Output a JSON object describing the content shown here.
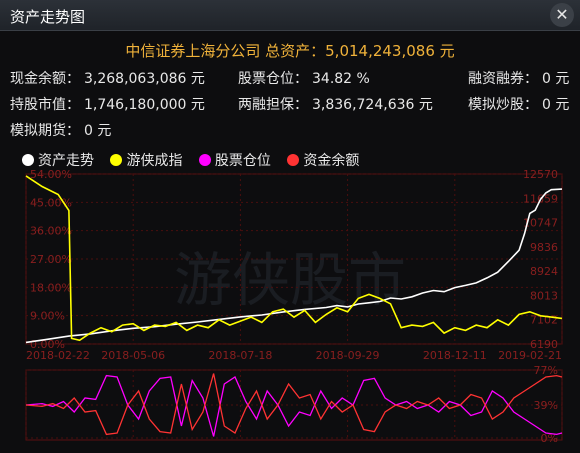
{
  "window": {
    "title": "资产走势图",
    "close_glyph": "✕"
  },
  "summary": {
    "headline": "中信证券上海分公司 总资产：5,014,243,086 元",
    "rows": [
      [
        {
          "label": "现金余额：",
          "value": "3,268,063,086 元"
        },
        {
          "label": "股票仓位：",
          "value": "34.82 %"
        },
        {
          "label": "融资融券：",
          "value": "0 元"
        }
      ],
      [
        {
          "label": "持股市值：",
          "value": "1,746,180,000 元"
        },
        {
          "label": "两融担保：",
          "value": "3,836,724,636 元"
        },
        {
          "label": "模拟炒股：",
          "value": "0 元"
        }
      ],
      [
        {
          "label": "模拟期货：",
          "value": "0 元"
        }
      ]
    ]
  },
  "legend": [
    {
      "name": "资产走势",
      "color": "#ffffff"
    },
    {
      "name": "游侠成指",
      "color": "#ffff00"
    },
    {
      "name": "股票仓位",
      "color": "#ff00ff"
    },
    {
      "name": "资金余额",
      "color": "#ff3333"
    }
  ],
  "watermark": "游侠股市",
  "chart_data": [
    {
      "type": "line",
      "x_ticks": [
        "2018-02-22",
        "2018-05-06",
        "2018-07-18",
        "2018-09-29",
        "2018-12-11",
        "2019-02-21"
      ],
      "y_left_ticks": [
        "0.00%",
        "9.00%",
        "18.00%",
        "27.00%",
        "36.00%",
        "45.00%",
        "54.00%"
      ],
      "y_right_ticks": [
        "6190",
        "7102",
        "8013",
        "8924",
        "9836",
        "10747",
        "11659",
        "12570"
      ],
      "left_range": [
        0,
        54
      ],
      "right_range": [
        6190,
        12570
      ],
      "grid": true,
      "series": [
        {
          "name": "资产走势",
          "color": "#ffffff",
          "axis": "left",
          "points": [
            [
              0,
              0.5
            ],
            [
              4,
              1.5
            ],
            [
              8,
              2.5
            ],
            [
              12,
              3.2
            ],
            [
              16,
              4.2
            ],
            [
              20,
              5.0
            ],
            [
              24,
              5.5
            ],
            [
              28,
              6.3
            ],
            [
              32,
              7.0
            ],
            [
              36,
              7.8
            ],
            [
              40,
              8.6
            ],
            [
              44,
              9.2
            ],
            [
              48,
              10.2
            ],
            [
              52,
              11.0
            ],
            [
              56,
              11.6
            ],
            [
              58,
              12.2
            ],
            [
              60,
              11.8
            ],
            [
              62,
              12.7
            ],
            [
              64,
              13.1
            ],
            [
              66,
              13.5
            ],
            [
              68,
              14.6
            ],
            [
              70,
              14.3
            ],
            [
              72,
              15.0
            ],
            [
              74,
              16.2
            ],
            [
              76,
              17.0
            ],
            [
              78,
              16.6
            ],
            [
              80,
              17.9
            ],
            [
              82,
              18.6
            ],
            [
              84,
              19.4
            ],
            [
              86,
              21.0
            ],
            [
              88,
              22.8
            ],
            [
              90,
              26.2
            ],
            [
              92,
              29.8
            ],
            [
              93,
              35.0
            ],
            [
              94,
              41.5
            ],
            [
              95,
              42.5
            ],
            [
              96,
              46.0
            ],
            [
              97,
              48.0
            ],
            [
              98,
              49.0
            ],
            [
              100,
              49.2
            ]
          ]
        },
        {
          "name": "游侠成指",
          "color": "#ffff00",
          "axis": "right",
          "points": [
            [
              0,
              12500
            ],
            [
              3,
              12100
            ],
            [
              6,
              11800
            ],
            [
              8,
              11200
            ],
            [
              8.5,
              6400
            ],
            [
              10,
              6330
            ],
            [
              12,
              6600
            ],
            [
              14,
              6800
            ],
            [
              16,
              6650
            ],
            [
              18,
              6900
            ],
            [
              20,
              6950
            ],
            [
              22,
              6700
            ],
            [
              24,
              6900
            ],
            [
              26,
              6850
            ],
            [
              28,
              7000
            ],
            [
              30,
              6700
            ],
            [
              32,
              6900
            ],
            [
              34,
              6800
            ],
            [
              36,
              7100
            ],
            [
              38,
              6900
            ],
            [
              40,
              7050
            ],
            [
              42,
              7200
            ],
            [
              44,
              7000
            ],
            [
              46,
              7400
            ],
            [
              48,
              7500
            ],
            [
              50,
              7200
            ],
            [
              52,
              7450
            ],
            [
              54,
              7000
            ],
            [
              56,
              7300
            ],
            [
              58,
              7550
            ],
            [
              60,
              7400
            ],
            [
              62,
              7900
            ],
            [
              64,
              8050
            ],
            [
              66,
              7900
            ],
            [
              68,
              7700
            ],
            [
              70,
              6800
            ],
            [
              72,
              6900
            ],
            [
              74,
              6850
            ],
            [
              76,
              7000
            ],
            [
              78,
              6600
            ],
            [
              80,
              6800
            ],
            [
              82,
              6700
            ],
            [
              84,
              6900
            ],
            [
              86,
              6800
            ],
            [
              88,
              7100
            ],
            [
              90,
              6900
            ],
            [
              92,
              7300
            ],
            [
              94,
              7400
            ],
            [
              96,
              7250
            ],
            [
              98,
              7200
            ],
            [
              100,
              7150
            ]
          ]
        }
      ]
    },
    {
      "type": "line",
      "y_right_ticks": [
        "0%",
        "39%",
        "77%"
      ],
      "y_range": [
        0,
        100
      ],
      "series": [
        {
          "name": "股票仓位",
          "color": "#ff00ff",
          "axis": "right",
          "points": [
            [
              0,
              50
            ],
            [
              3,
              52
            ],
            [
              5,
              48
            ],
            [
              7,
              55
            ],
            [
              9,
              40
            ],
            [
              11,
              60
            ],
            [
              13,
              58
            ],
            [
              15,
              92
            ],
            [
              17,
              90
            ],
            [
              19,
              50
            ],
            [
              21,
              30
            ],
            [
              23,
              70
            ],
            [
              25,
              88
            ],
            [
              27,
              90
            ],
            [
              29,
              20
            ],
            [
              31,
              85
            ],
            [
              33,
              60
            ],
            [
              35,
              5
            ],
            [
              37,
              80
            ],
            [
              39,
              90
            ],
            [
              41,
              55
            ],
            [
              43,
              30
            ],
            [
              45,
              70
            ],
            [
              47,
              50
            ],
            [
              49,
              20
            ],
            [
              51,
              40
            ],
            [
              53,
              35
            ],
            [
              55,
              70
            ],
            [
              57,
              45
            ],
            [
              59,
              60
            ],
            [
              61,
              50
            ],
            [
              63,
              85
            ],
            [
              65,
              88
            ],
            [
              67,
              60
            ],
            [
              69,
              50
            ],
            [
              71,
              55
            ],
            [
              73,
              45
            ],
            [
              75,
              50
            ],
            [
              77,
              40
            ],
            [
              79,
              55
            ],
            [
              81,
              50
            ],
            [
              83,
              35
            ],
            [
              85,
              40
            ],
            [
              87,
              70
            ],
            [
              89,
              60
            ],
            [
              91,
              40
            ],
            [
              93,
              30
            ],
            [
              95,
              20
            ],
            [
              97,
              10
            ],
            [
              99,
              8
            ],
            [
              100,
              10
            ]
          ]
        },
        {
          "name": "资金余额",
          "color": "#ff3333",
          "axis": "right",
          "points": [
            [
              0,
              50
            ],
            [
              3,
              48
            ],
            [
              5,
              52
            ],
            [
              7,
              45
            ],
            [
              9,
              60
            ],
            [
              11,
              40
            ],
            [
              13,
              42
            ],
            [
              15,
              8
            ],
            [
              17,
              10
            ],
            [
              19,
              50
            ],
            [
              21,
              70
            ],
            [
              23,
              30
            ],
            [
              25,
              12
            ],
            [
              27,
              10
            ],
            [
              29,
              80
            ],
            [
              31,
              15
            ],
            [
              33,
              40
            ],
            [
              35,
              95
            ],
            [
              37,
              20
            ],
            [
              39,
              10
            ],
            [
              41,
              45
            ],
            [
              43,
              70
            ],
            [
              45,
              30
            ],
            [
              47,
              50
            ],
            [
              49,
              80
            ],
            [
              51,
              60
            ],
            [
              53,
              65
            ],
            [
              55,
              30
            ],
            [
              57,
              55
            ],
            [
              59,
              40
            ],
            [
              61,
              50
            ],
            [
              63,
              15
            ],
            [
              65,
              12
            ],
            [
              67,
              40
            ],
            [
              69,
              50
            ],
            [
              71,
              45
            ],
            [
              73,
              55
            ],
            [
              75,
              50
            ],
            [
              77,
              60
            ],
            [
              79,
              45
            ],
            [
              81,
              50
            ],
            [
              83,
              65
            ],
            [
              85,
              60
            ],
            [
              87,
              30
            ],
            [
              89,
              40
            ],
            [
              91,
              60
            ],
            [
              93,
              70
            ],
            [
              95,
              80
            ],
            [
              97,
              90
            ],
            [
              99,
              92
            ],
            [
              100,
              90
            ]
          ]
        }
      ]
    }
  ]
}
